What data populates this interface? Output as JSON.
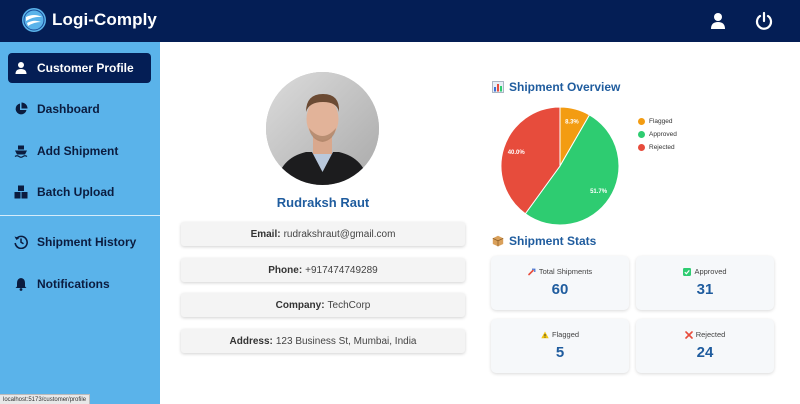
{
  "app": {
    "title": "Logi-Comply"
  },
  "topbar": {
    "icons": [
      "user-icon",
      "power-icon"
    ]
  },
  "sidebar": {
    "items": [
      {
        "label": "Customer Profile",
        "icon": "user-icon",
        "active": true
      },
      {
        "label": "Dashboard",
        "icon": "pie-icon",
        "active": false
      },
      {
        "label": "Add Shipment",
        "icon": "ship-icon",
        "active": false
      },
      {
        "label": "Batch Upload",
        "icon": "boxes-icon",
        "active": false
      },
      {
        "label": "Shipment History",
        "icon": "history-icon",
        "active": false
      },
      {
        "label": "Notifications",
        "icon": "bell-icon",
        "active": false
      }
    ]
  },
  "status_bar": {
    "url": "localhost:5173/customer/profile"
  },
  "profile": {
    "name": "Rudraksh Raut",
    "fields": [
      {
        "label": "Email:",
        "value": "rudrakshraut@gmail.com"
      },
      {
        "label": "Phone:",
        "value": "+917474749289"
      },
      {
        "label": "Company:",
        "value": "TechCorp"
      },
      {
        "label": "Address:",
        "value": "123 Business St, Mumbai, India"
      }
    ]
  },
  "overview": {
    "title": "Shipment Overview"
  },
  "stats": {
    "title": "Shipment Stats",
    "cards": [
      {
        "label": "Total Shipments",
        "value": "60",
        "icon": "truck-icon"
      },
      {
        "label": "Approved",
        "value": "31",
        "icon": "check-icon"
      },
      {
        "label": "Flagged",
        "value": "5",
        "icon": "warning-icon"
      },
      {
        "label": "Rejected",
        "value": "24",
        "icon": "cross-icon"
      }
    ]
  },
  "colors": {
    "topbar": "#041e55",
    "sidebar": "#5ab3ea",
    "accent": "#1f5c9e",
    "flagged": "#f39c12",
    "approved": "#2ecc71",
    "rejected": "#e74c3c"
  },
  "chart_data": {
    "type": "pie",
    "categories": [
      "Flagged",
      "Approved",
      "Rejected"
    ],
    "values": [
      5,
      31,
      24
    ],
    "labels": [
      "8.3%",
      "51.7%",
      "40.0%"
    ],
    "colors": [
      "#f39c12",
      "#2ecc71",
      "#e74c3c"
    ],
    "legend": "right"
  }
}
